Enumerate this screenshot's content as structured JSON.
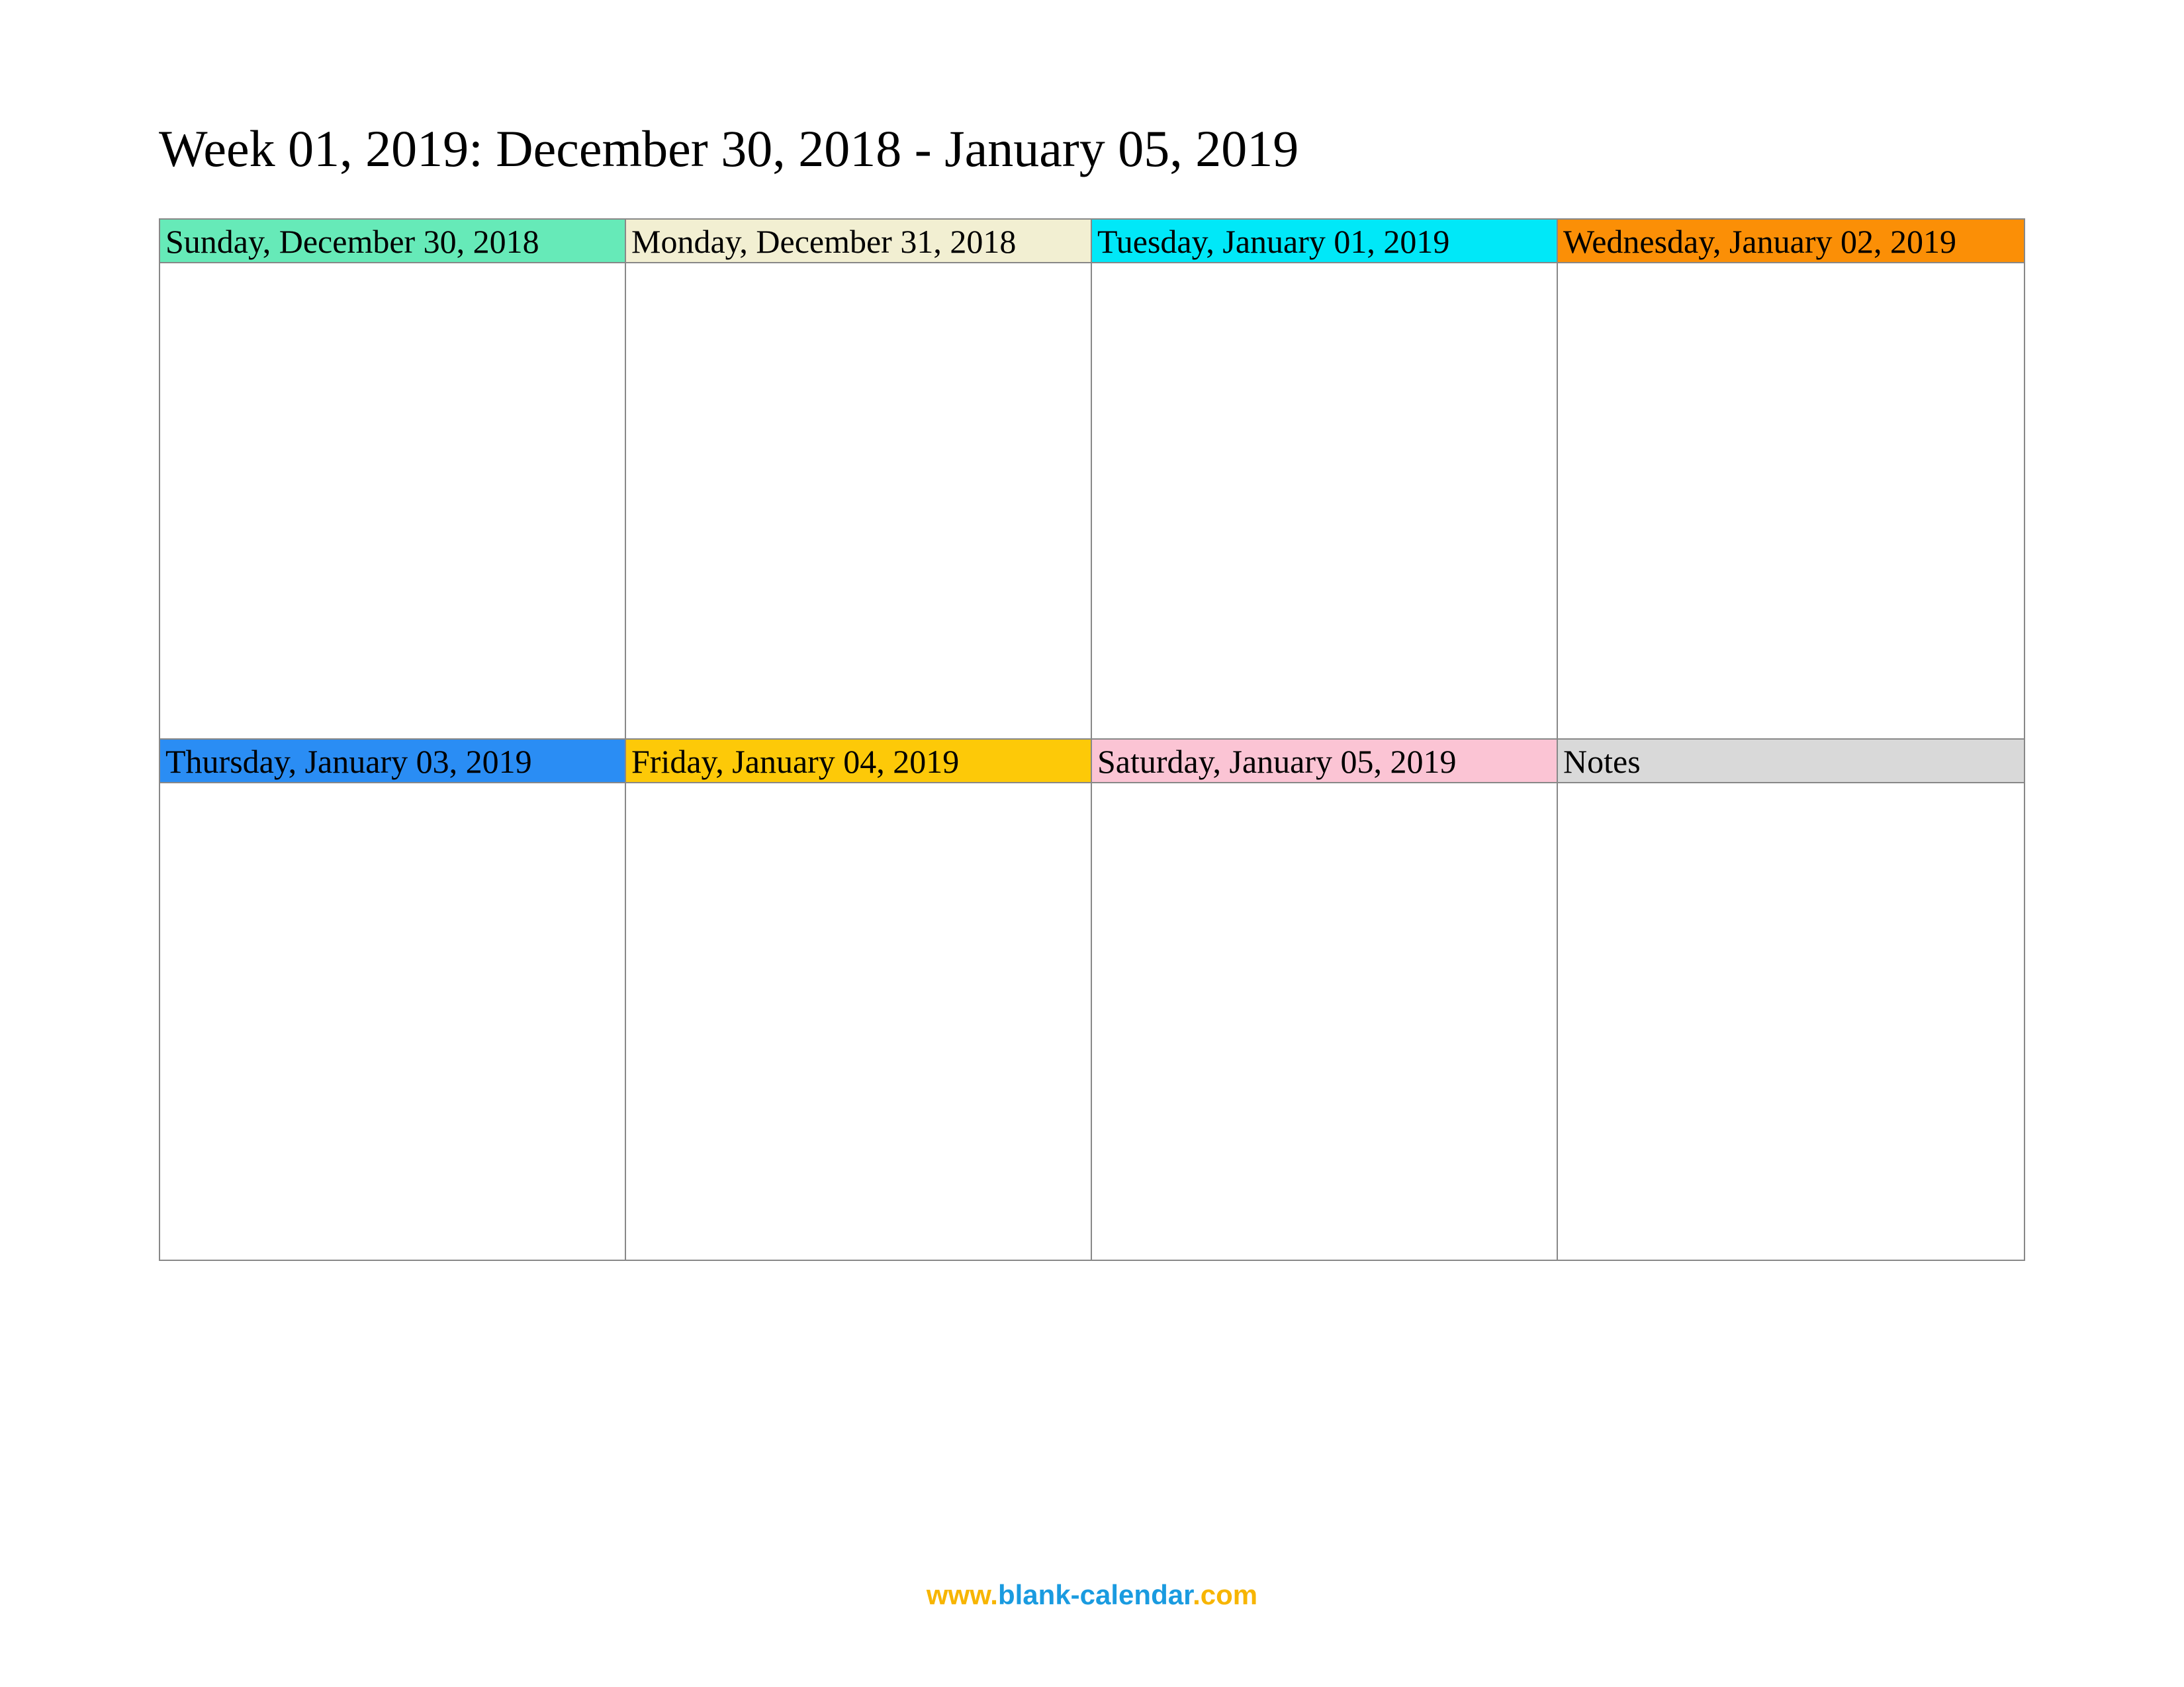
{
  "title": "Week 01, 2019: December 30, 2018 - January 05, 2019",
  "cells": {
    "sun": {
      "label": "Sunday, December 30, 2018",
      "bg": "#66eab8"
    },
    "mon": {
      "label": "Monday, December 31, 2018",
      "bg": "#f2efd2"
    },
    "tue": {
      "label": "Tuesday, January 01, 2019",
      "bg": "#00e8f8"
    },
    "wed": {
      "label": "Wednesday, January 02, 2019",
      "bg": "#fb8f06"
    },
    "thu": {
      "label": "Thursday, January 03, 2019",
      "bg": "#2a8df4"
    },
    "fri": {
      "label": "Friday, January 04, 2019",
      "bg": "#fdc908"
    },
    "sat": {
      "label": "Saturday, January 05, 2019",
      "bg": "#fbc4d4"
    },
    "notes": {
      "label": "Notes",
      "bg": "#d9d9d9"
    }
  },
  "footer": {
    "part1": {
      "text": "www.",
      "color": "#f7b500"
    },
    "part2": {
      "text": "blank-calendar",
      "color": "#1a9be0"
    },
    "part3": {
      "text": ".com",
      "color": "#f7b500"
    }
  }
}
